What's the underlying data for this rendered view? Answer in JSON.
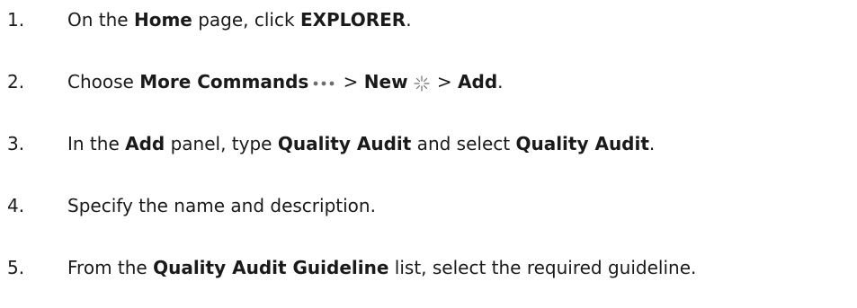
{
  "steps": [
    {
      "number": "1.",
      "parts": [
        "On the ",
        "Home",
        " page, click ",
        "EXPLORER",
        "."
      ]
    },
    {
      "number": "2.",
      "parts": [
        "Choose ",
        "More Commands",
        " > ",
        "New",
        " > ",
        "Add",
        "."
      ],
      "icons": [
        "more-commands-icon",
        "new-sparkle-icon"
      ]
    },
    {
      "number": "3.",
      "parts": [
        "In the ",
        "Add",
        " panel, type ",
        "Quality Audit",
        " and select ",
        "Quality Audit",
        "."
      ]
    },
    {
      "number": "4.",
      "parts": [
        "Specify the name and description."
      ]
    },
    {
      "number": "5.",
      "parts": [
        "From the ",
        "Quality Audit Guideline",
        " list, select the required guideline."
      ]
    }
  ],
  "colors": {
    "text": "#1a1a1a",
    "icon": "#6e6e6e"
  }
}
